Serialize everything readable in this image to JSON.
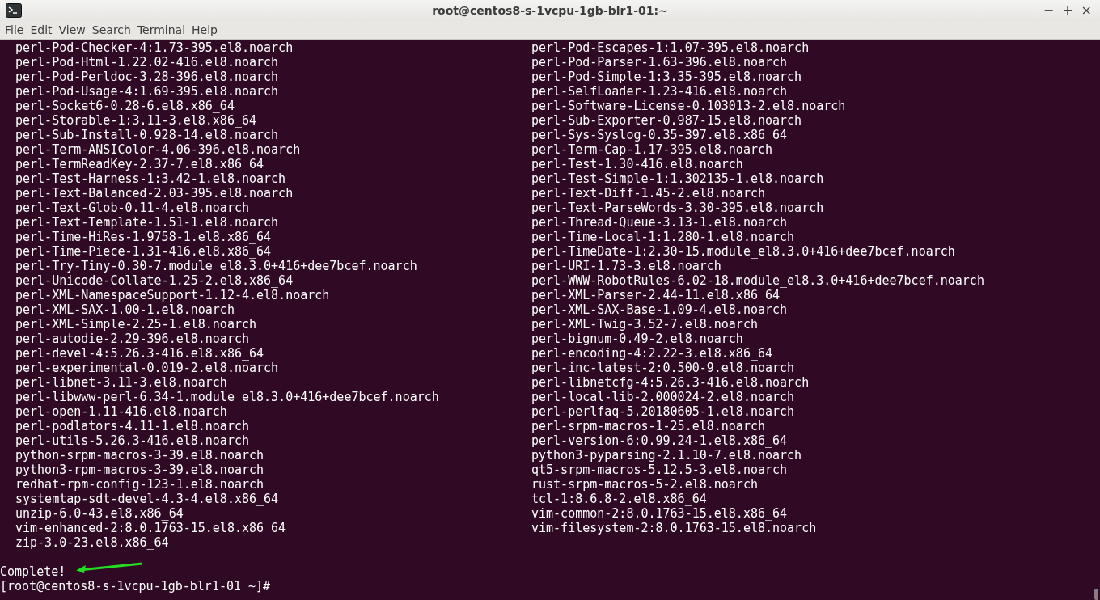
{
  "window": {
    "title": "root@centos8-s-1vcpu-1gb-blr1-01:~",
    "controls": [
      "−",
      "+",
      "×"
    ]
  },
  "menu": [
    "File",
    "Edit",
    "View",
    "Search",
    "Terminal",
    "Help"
  ],
  "terminal": {
    "rows": [
      {
        "column_1": "perl-Pod-Checker-4:1.73-395.el8.noarch",
        "column_2": "perl-Pod-Escapes-1:1.07-395.el8.noarch"
      },
      {
        "column_1": "perl-Pod-Html-1.22.02-416.el8.noarch",
        "column_2": "perl-Pod-Parser-1.63-396.el8.noarch"
      },
      {
        "column_1": "perl-Pod-Perldoc-3.28-396.el8.noarch",
        "column_2": "perl-Pod-Simple-1:3.35-395.el8.noarch"
      },
      {
        "column_1": "perl-Pod-Usage-4:1.69-395.el8.noarch",
        "column_2": "perl-SelfLoader-1.23-416.el8.noarch"
      },
      {
        "column_1": "perl-Socket6-0.28-6.el8.x86_64",
        "column_2": "perl-Software-License-0.103013-2.el8.noarch"
      },
      {
        "column_1": "perl-Storable-1:3.11-3.el8.x86_64",
        "column_2": "perl-Sub-Exporter-0.987-15.el8.noarch"
      },
      {
        "column_1": "perl-Sub-Install-0.928-14.el8.noarch",
        "column_2": "perl-Sys-Syslog-0.35-397.el8.x86_64"
      },
      {
        "column_1": "perl-Term-ANSIColor-4.06-396.el8.noarch",
        "column_2": "perl-Term-Cap-1.17-395.el8.noarch"
      },
      {
        "column_1": "perl-TermReadKey-2.37-7.el8.x86_64",
        "column_2": "perl-Test-1.30-416.el8.noarch"
      },
      {
        "column_1": "perl-Test-Harness-1:3.42-1.el8.noarch",
        "column_2": "perl-Test-Simple-1:1.302135-1.el8.noarch"
      },
      {
        "column_1": "perl-Text-Balanced-2.03-395.el8.noarch",
        "column_2": "perl-Text-Diff-1.45-2.el8.noarch"
      },
      {
        "column_1": "perl-Text-Glob-0.11-4.el8.noarch",
        "column_2": "perl-Text-ParseWords-3.30-395.el8.noarch"
      },
      {
        "column_1": "perl-Text-Template-1.51-1.el8.noarch",
        "column_2": "perl-Thread-Queue-3.13-1.el8.noarch"
      },
      {
        "column_1": "perl-Time-HiRes-1.9758-1.el8.x86_64",
        "column_2": "perl-Time-Local-1:1.280-1.el8.noarch"
      },
      {
        "column_1": "perl-Time-Piece-1.31-416.el8.x86_64",
        "column_2": "perl-TimeDate-1:2.30-15.module_el8.3.0+416+dee7bcef.noarch"
      },
      {
        "column_1": "perl-Try-Tiny-0.30-7.module_el8.3.0+416+dee7bcef.noarch",
        "column_2": "perl-URI-1.73-3.el8.noarch"
      },
      {
        "column_1": "perl-Unicode-Collate-1.25-2.el8.x86_64",
        "column_2": "perl-WWW-RobotRules-6.02-18.module_el8.3.0+416+dee7bcef.noarch"
      },
      {
        "column_1": "perl-XML-NamespaceSupport-1.12-4.el8.noarch",
        "column_2": "perl-XML-Parser-2.44-11.el8.x86_64"
      },
      {
        "column_1": "perl-XML-SAX-1.00-1.el8.noarch",
        "column_2": "perl-XML-SAX-Base-1.09-4.el8.noarch"
      },
      {
        "column_1": "perl-XML-Simple-2.25-1.el8.noarch",
        "column_2": "perl-XML-Twig-3.52-7.el8.noarch"
      },
      {
        "column_1": "perl-autodie-2.29-396.el8.noarch",
        "column_2": "perl-bignum-0.49-2.el8.noarch"
      },
      {
        "column_1": "perl-devel-4:5.26.3-416.el8.x86_64",
        "column_2": "perl-encoding-4:2.22-3.el8.x86_64"
      },
      {
        "column_1": "perl-experimental-0.019-2.el8.noarch",
        "column_2": "perl-inc-latest-2:0.500-9.el8.noarch"
      },
      {
        "column_1": "perl-libnet-3.11-3.el8.noarch",
        "column_2": "perl-libnetcfg-4:5.26.3-416.el8.noarch"
      },
      {
        "column_1": "perl-libwww-perl-6.34-1.module_el8.3.0+416+dee7bcef.noarch",
        "column_2": "perl-local-lib-2.000024-2.el8.noarch"
      },
      {
        "column_1": "perl-open-1.11-416.el8.noarch",
        "column_2": "perl-perlfaq-5.20180605-1.el8.noarch"
      },
      {
        "column_1": "perl-podlators-4.11-1.el8.noarch",
        "column_2": "perl-srpm-macros-1-25.el8.noarch"
      },
      {
        "column_1": "perl-utils-5.26.3-416.el8.noarch",
        "column_2": "perl-version-6:0.99.24-1.el8.x86_64"
      },
      {
        "column_1": "python-srpm-macros-3-39.el8.noarch",
        "column_2": "python3-pyparsing-2.1.10-7.el8.noarch"
      },
      {
        "column_1": "python3-rpm-macros-3-39.el8.noarch",
        "column_2": "qt5-srpm-macros-5.12.5-3.el8.noarch"
      },
      {
        "column_1": "redhat-rpm-config-123-1.el8.noarch",
        "column_2": "rust-srpm-macros-5-2.el8.noarch"
      },
      {
        "column_1": "systemtap-sdt-devel-4.3-4.el8.x86_64",
        "column_2": "tcl-1:8.6.8-2.el8.x86_64"
      },
      {
        "column_1": "unzip-6.0-43.el8.x86_64",
        "column_2": "vim-common-2:8.0.1763-15.el8.x86_64"
      },
      {
        "column_1": "vim-enhanced-2:8.0.1763-15.el8.x86_64",
        "column_2": "vim-filesystem-2:8.0.1763-15.el8.noarch"
      },
      {
        "column_1": "zip-3.0-23.el8.x86_64"
      }
    ],
    "status": "Complete!",
    "prompt": "[root@centos8-s-1vcpu-1gb-blr1-01 ~]#"
  }
}
